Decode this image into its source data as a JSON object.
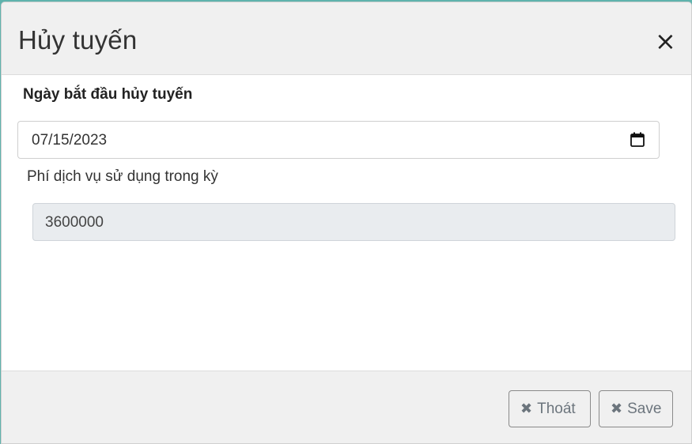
{
  "modal": {
    "title": "Hủy tuyến",
    "close_glyph": "×"
  },
  "form": {
    "start_date_label": "Ngày bắt đầu hủy tuyến",
    "start_date_value": "07/15/2023",
    "fee_label": "Phí dịch vụ sử dụng trong kỳ",
    "fee_value": "3600000"
  },
  "footer": {
    "exit_label": "Thoát",
    "save_label": "Save",
    "x_glyph": "✖"
  },
  "icons": {
    "close": "close-icon",
    "calendar": "calendar-icon",
    "times": "times-icon"
  },
  "colors": {
    "header_bg": "#f0f0f0",
    "readonly_bg": "#e9ecef",
    "button_text": "#6c757d"
  }
}
